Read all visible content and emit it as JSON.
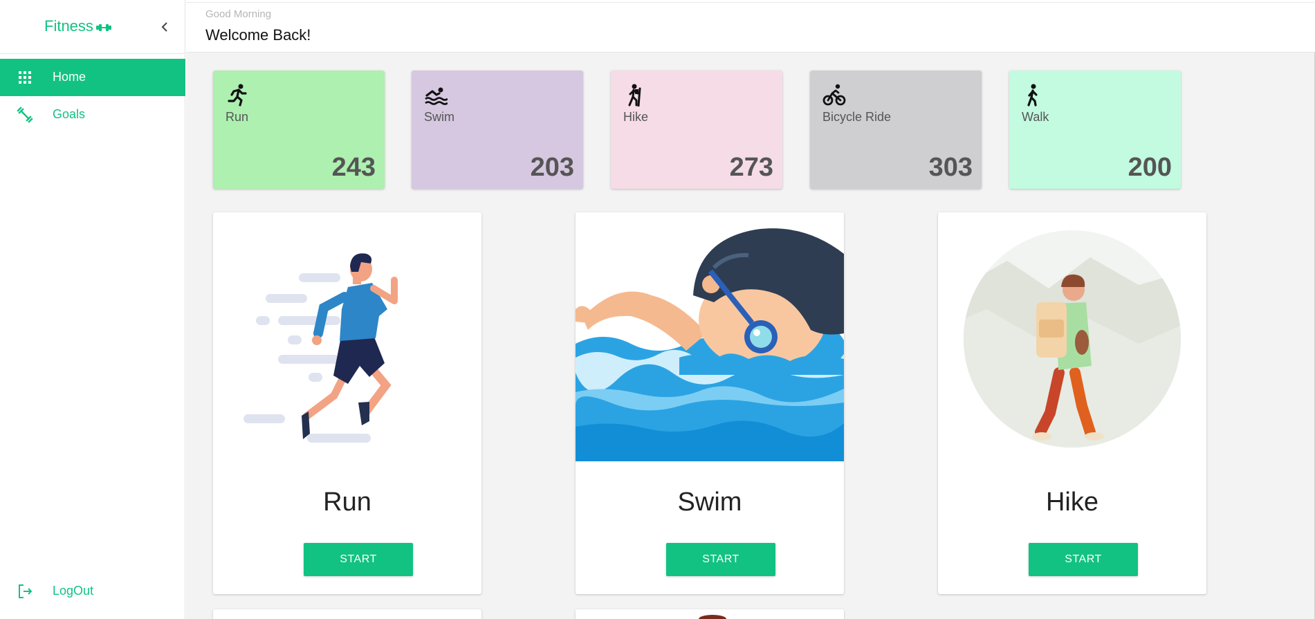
{
  "app": {
    "brand": "Fitness"
  },
  "header": {
    "greeting": "Good Morning",
    "welcome": "Welcome Back!"
  },
  "sidebar": {
    "items": [
      {
        "label": "Home",
        "icon": "apps-grid-icon",
        "active": true
      },
      {
        "label": "Goals",
        "icon": "dumbbell-icon",
        "active": false
      }
    ],
    "logout": {
      "label": "LogOut",
      "icon": "logout-icon"
    }
  },
  "stats": [
    {
      "label": "Run",
      "value": "243",
      "icon": "run-icon",
      "color": "#adf0b0"
    },
    {
      "label": "Swim",
      "value": "203",
      "icon": "swim-icon",
      "color": "#d6c8e0"
    },
    {
      "label": "Hike",
      "value": "273",
      "icon": "hike-icon",
      "color": "#f6dce6"
    },
    {
      "label": "Bicycle Ride",
      "value": "303",
      "icon": "bike-icon",
      "color": "#cfcfd1"
    },
    {
      "label": "Walk",
      "value": "200",
      "icon": "walk-icon",
      "color": "#c2fbe0"
    }
  ],
  "activities": [
    {
      "title": "Run",
      "button": "START"
    },
    {
      "title": "Swim",
      "button": "START"
    },
    {
      "title": "Hike",
      "button": "START"
    }
  ],
  "colors": {
    "accent": "#12c282",
    "background": "#f3f3f3"
  }
}
